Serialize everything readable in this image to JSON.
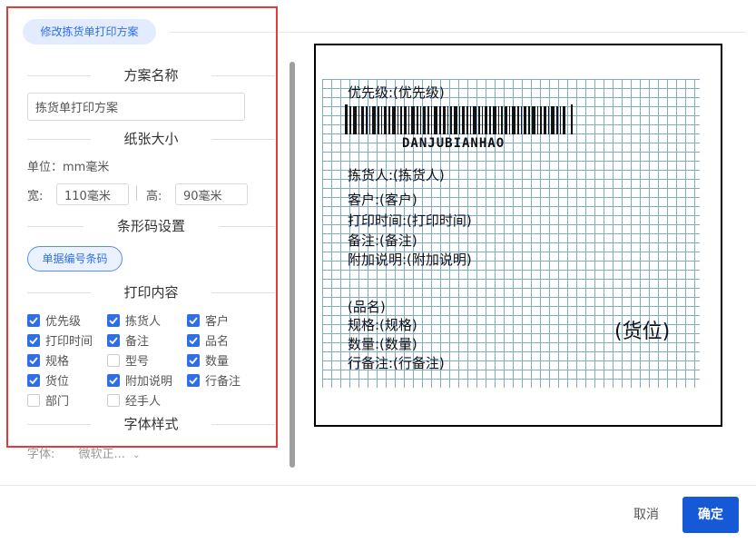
{
  "tab": {
    "label": "修改拣货单打印方案"
  },
  "sections": {
    "scheme_name": "方案名称",
    "paper_size": "纸张大小",
    "barcode": "条形码设置",
    "print_content": "打印内容",
    "font_style": "字体样式"
  },
  "scheme_input": {
    "value": "拣货单打印方案"
  },
  "paper": {
    "unit_text": "单位：mm毫米",
    "width_label": "宽:",
    "width_value": "110毫米",
    "height_label": "高:",
    "height_value": "90毫米"
  },
  "barcode_button": "单据编号条码",
  "checkboxes": [
    {
      "label": "优先级",
      "checked": true
    },
    {
      "label": "拣货人",
      "checked": true
    },
    {
      "label": "客户",
      "checked": true
    },
    {
      "label": "打印时间",
      "checked": true
    },
    {
      "label": "备注",
      "checked": true
    },
    {
      "label": "品名",
      "checked": true
    },
    {
      "label": "规格",
      "checked": true
    },
    {
      "label": "型号",
      "checked": false
    },
    {
      "label": "数量",
      "checked": true
    },
    {
      "label": "货位",
      "checked": true
    },
    {
      "label": "附加说明",
      "checked": true
    },
    {
      "label": "行备注",
      "checked": true
    },
    {
      "label": "部门",
      "checked": false
    },
    {
      "label": "经手人",
      "checked": false
    }
  ],
  "font": {
    "label": "字体:",
    "value": "微软正..."
  },
  "preview": {
    "priority": "优先级:(优先级)",
    "barcode_text": "DANJUBIANHAO",
    "picker": "拣货人:(拣货人)",
    "customer": "客户:(客户)",
    "print_time": "打印时间:(打印时间)",
    "remark": "备注:(备注)",
    "extra": "附加说明:(附加说明)",
    "product": "(品名)",
    "spec": "规格:(规格)",
    "quantity": "数量:(数量)",
    "line_remark": "行备注:(行备注)",
    "location": "(货位)"
  },
  "footer": {
    "cancel": "取消",
    "ok": "确定"
  },
  "colors": {
    "accent": "#1559d6",
    "highlight_frame": "#e23b3b",
    "grid": "#7aa7e6"
  }
}
